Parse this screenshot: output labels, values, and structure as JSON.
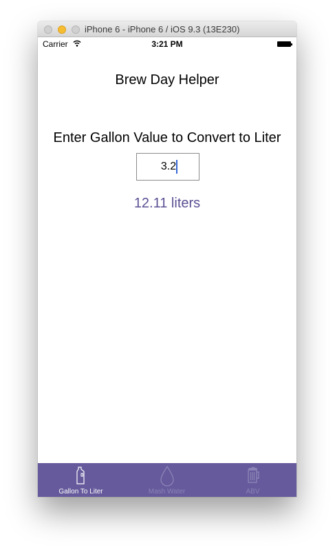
{
  "window": {
    "title": "iPhone 6 - iPhone 6 / iOS 9.3 (13E230)"
  },
  "status_bar": {
    "carrier": "Carrier",
    "time": "3:21 PM",
    "icons": [
      "wifi-icon",
      "battery-icon"
    ]
  },
  "app": {
    "title": "Brew Day Helper",
    "prompt": "Enter Gallon Value to Convert to Liter",
    "input_value": "3.2",
    "result": "12.11 liters"
  },
  "tab_bar": {
    "tabs": [
      {
        "label": "Gallon To Liter",
        "icon": "jug-icon",
        "selected": true
      },
      {
        "label": "Mash Water",
        "icon": "water-drop-icon",
        "selected": false
      },
      {
        "label": "ABV",
        "icon": "beer-mug-icon",
        "selected": false
      }
    ]
  },
  "colors": {
    "tab_bar_bg": "#665a9c",
    "result_text": "#5a4f93",
    "tab_active": "#ffffff",
    "tab_inactive": "#8c84b6"
  }
}
